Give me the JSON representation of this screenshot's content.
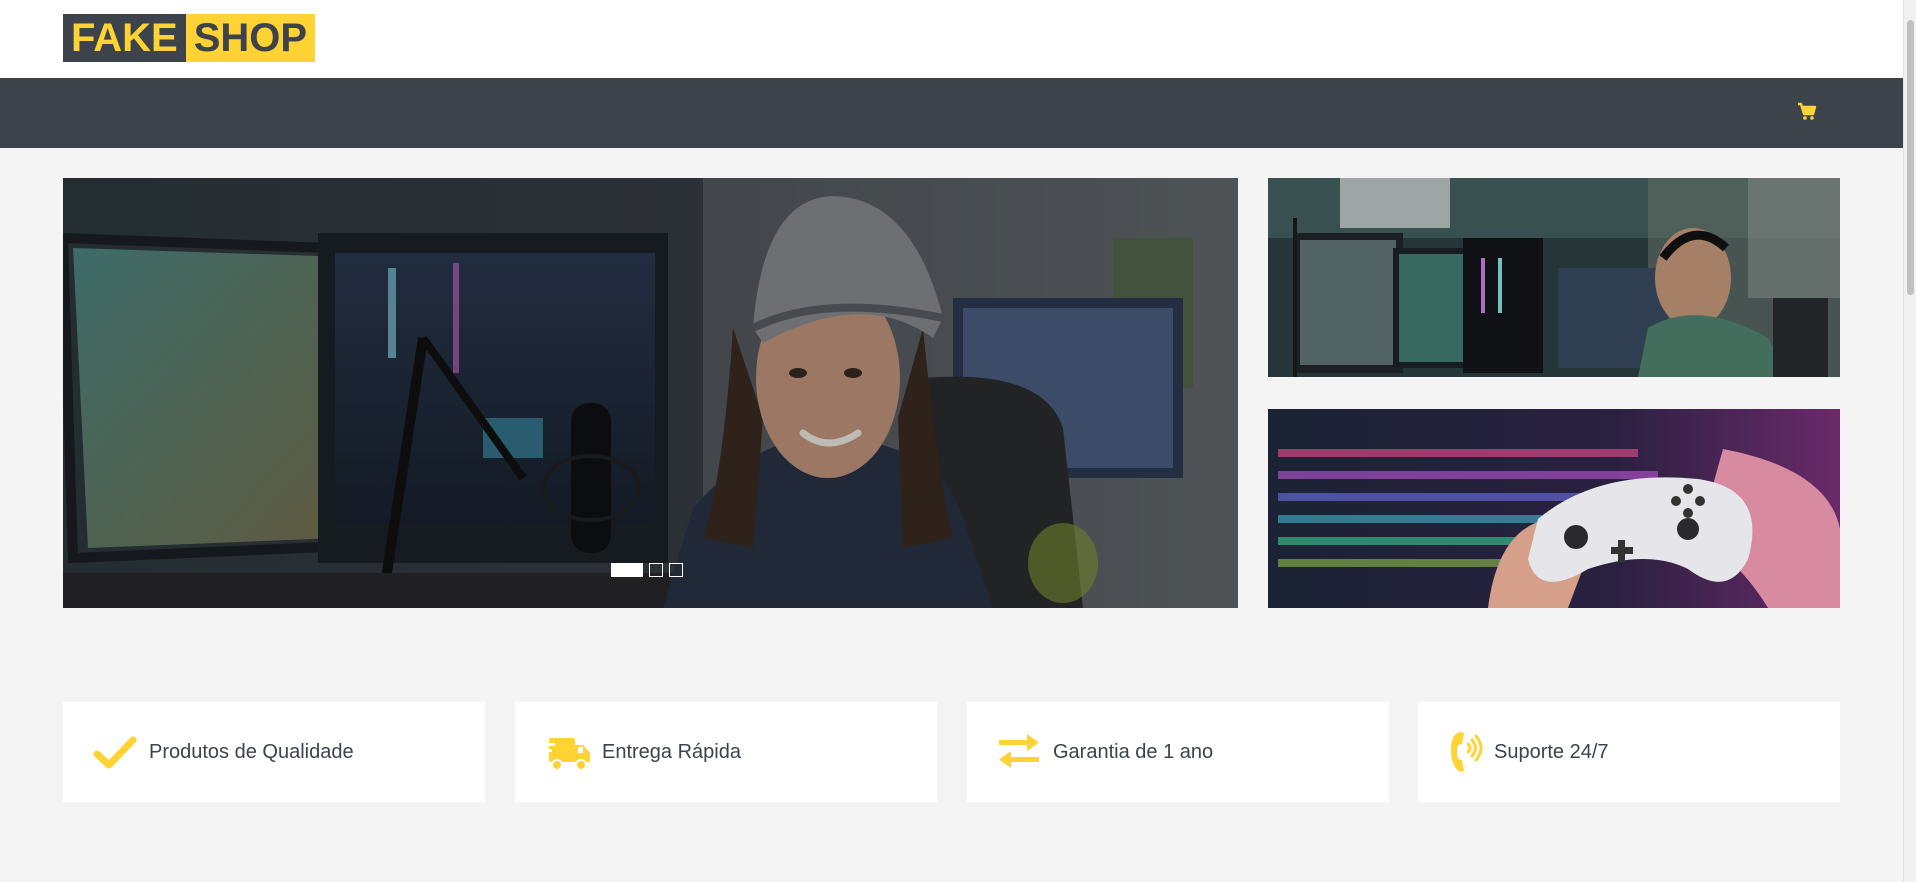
{
  "brand": {
    "part1": "FAKE",
    "part2": "SHOP"
  },
  "nav": {
    "cart_icon": "shopping-cart-icon"
  },
  "colors": {
    "accent": "#ffd333",
    "dark": "#3d434b",
    "background": "#f4f4f4"
  },
  "carousel": {
    "slide_count": 3,
    "active_index": 0
  },
  "features": [
    {
      "icon": "check-icon",
      "label": "Produtos de Qualidade"
    },
    {
      "icon": "shipping-fast-icon",
      "label": "Entrega Rápida"
    },
    {
      "icon": "exchange-arrows-icon",
      "label": "Garantia de 1 ano"
    },
    {
      "icon": "phone-volume-icon",
      "label": "Suporte 24/7"
    }
  ]
}
